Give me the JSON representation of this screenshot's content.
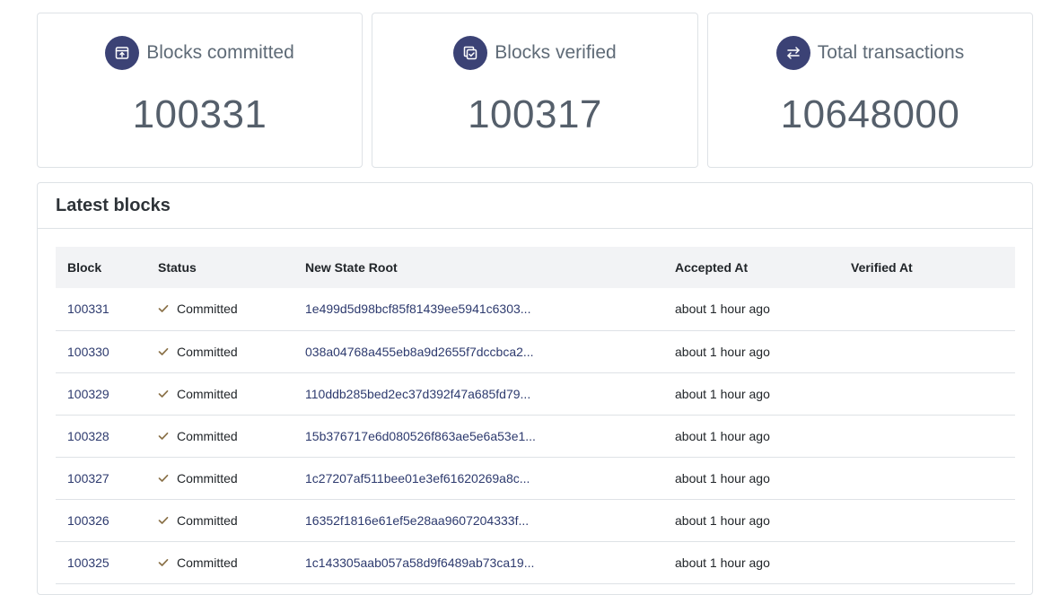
{
  "stats": [
    {
      "icon": "box-upload-icon",
      "label": "Blocks committed",
      "value": "100331"
    },
    {
      "icon": "verified-copy-icon",
      "label": "Blocks verified",
      "value": "100317"
    },
    {
      "icon": "swap-arrows-icon",
      "label": "Total transactions",
      "value": "10648000"
    }
  ],
  "latest_blocks": {
    "title": "Latest blocks",
    "columns": [
      "Block",
      "Status",
      "New State Root",
      "Accepted At",
      "Verified At"
    ],
    "rows": [
      {
        "block": "100331",
        "status": "Committed",
        "root": "1e499d5d98bcf85f81439ee5941c6303...",
        "accepted": "about 1 hour ago",
        "verified": ""
      },
      {
        "block": "100330",
        "status": "Committed",
        "root": "038a04768a455eb8a9d2655f7dccbca2...",
        "accepted": "about 1 hour ago",
        "verified": ""
      },
      {
        "block": "100329",
        "status": "Committed",
        "root": "110ddb285bed2ec37d392f47a685fd79...",
        "accepted": "about 1 hour ago",
        "verified": ""
      },
      {
        "block": "100328",
        "status": "Committed",
        "root": "15b376717e6d080526f863ae5e6a53e1...",
        "accepted": "about 1 hour ago",
        "verified": ""
      },
      {
        "block": "100327",
        "status": "Committed",
        "root": "1c27207af511bee01e3ef61620269a8c...",
        "accepted": "about 1 hour ago",
        "verified": ""
      },
      {
        "block": "100326",
        "status": "Committed",
        "root": "16352f1816e61ef5e28aa9607204333f...",
        "accepted": "about 1 hour ago",
        "verified": ""
      },
      {
        "block": "100325",
        "status": "Committed",
        "root": "1c143305aab057a58d9f6489ab73ca19...",
        "accepted": "about 1 hour ago",
        "verified": ""
      }
    ]
  },
  "colors": {
    "icon_bg": "#3b4275",
    "link": "#2d3a6e",
    "check": "#8a7148"
  }
}
